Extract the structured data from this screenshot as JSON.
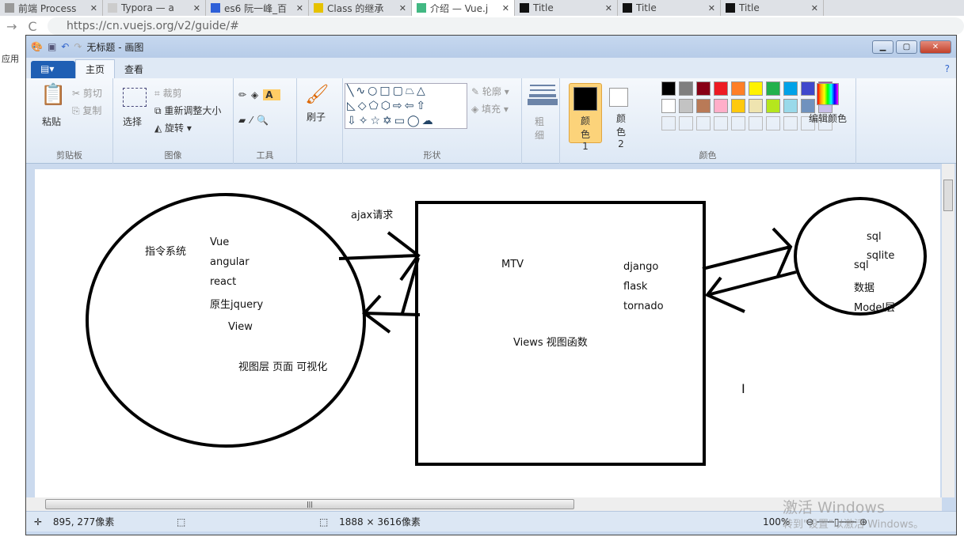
{
  "browser": {
    "tabs": [
      {
        "label": "前端 Process",
        "icon": "doc-icon"
      },
      {
        "label": "Typora — a",
        "icon": "typora-icon"
      },
      {
        "label": "es6 阮一峰_百",
        "icon": "baidu-icon"
      },
      {
        "label": "Class 的继承",
        "icon": "es-icon"
      },
      {
        "label": "介绍 — Vue.j",
        "icon": "vue-icon",
        "active": true
      },
      {
        "label": "Title",
        "icon": "pycharm-icon"
      },
      {
        "label": "Title",
        "icon": "pycharm-icon"
      },
      {
        "label": "Title",
        "icon": "pycharm-icon"
      }
    ],
    "url": "https://cn.vuejs.org/v2/guide/#",
    "apps": "应用"
  },
  "paint": {
    "title": "无标题 - 画图",
    "tabs": [
      "主页",
      "查看"
    ],
    "clipboard": {
      "paste": "粘贴",
      "cut": "剪切",
      "copy": "复制",
      "label": "剪贴板"
    },
    "image": {
      "select": "选择",
      "crop": "裁剪",
      "resize": "重新调整大小",
      "rotate": "旋转",
      "label": "图像"
    },
    "tools": {
      "label": "工具"
    },
    "brush": "刷子",
    "shapes": {
      "outline": "轮廓",
      "fill": "填充",
      "label": "形状"
    },
    "size": "粗细",
    "colors": {
      "color1": "颜色 1",
      "color2": "颜色 2",
      "edit": "编辑颜色",
      "label": "颜色",
      "palette": [
        "#000000",
        "#7f7f7f",
        "#880015",
        "#ed1c24",
        "#ff7f27",
        "#fff200",
        "#22b14c",
        "#00a2e8",
        "#3f48cc",
        "#a349a4",
        "#ffffff",
        "#c3c3c3",
        "#b97a57",
        "#ffaec9",
        "#ffc90e",
        "#efe4b0",
        "#b5e61d",
        "#99d9ea",
        "#7092be",
        "#c8bfe7"
      ]
    },
    "status": {
      "cursor": "895, 277像素",
      "size": "1888 × 3616像素",
      "zoom": "100%"
    }
  },
  "drawing": {
    "left": [
      "指令系统",
      "Vue",
      "angular",
      "react",
      "原生jquery",
      "View",
      "视图层 页面 可视化"
    ],
    "ajax": "ajax请求",
    "middle": [
      "MTV",
      "django",
      "flask",
      "tornado",
      "Views 视图函数"
    ],
    "right": [
      "sql",
      "sqlite",
      "sql",
      "数据",
      "Model层"
    ]
  },
  "watermark": {
    "line1": "激活 Windows",
    "line2": "转到\"设置\"以激活 Windows。"
  }
}
